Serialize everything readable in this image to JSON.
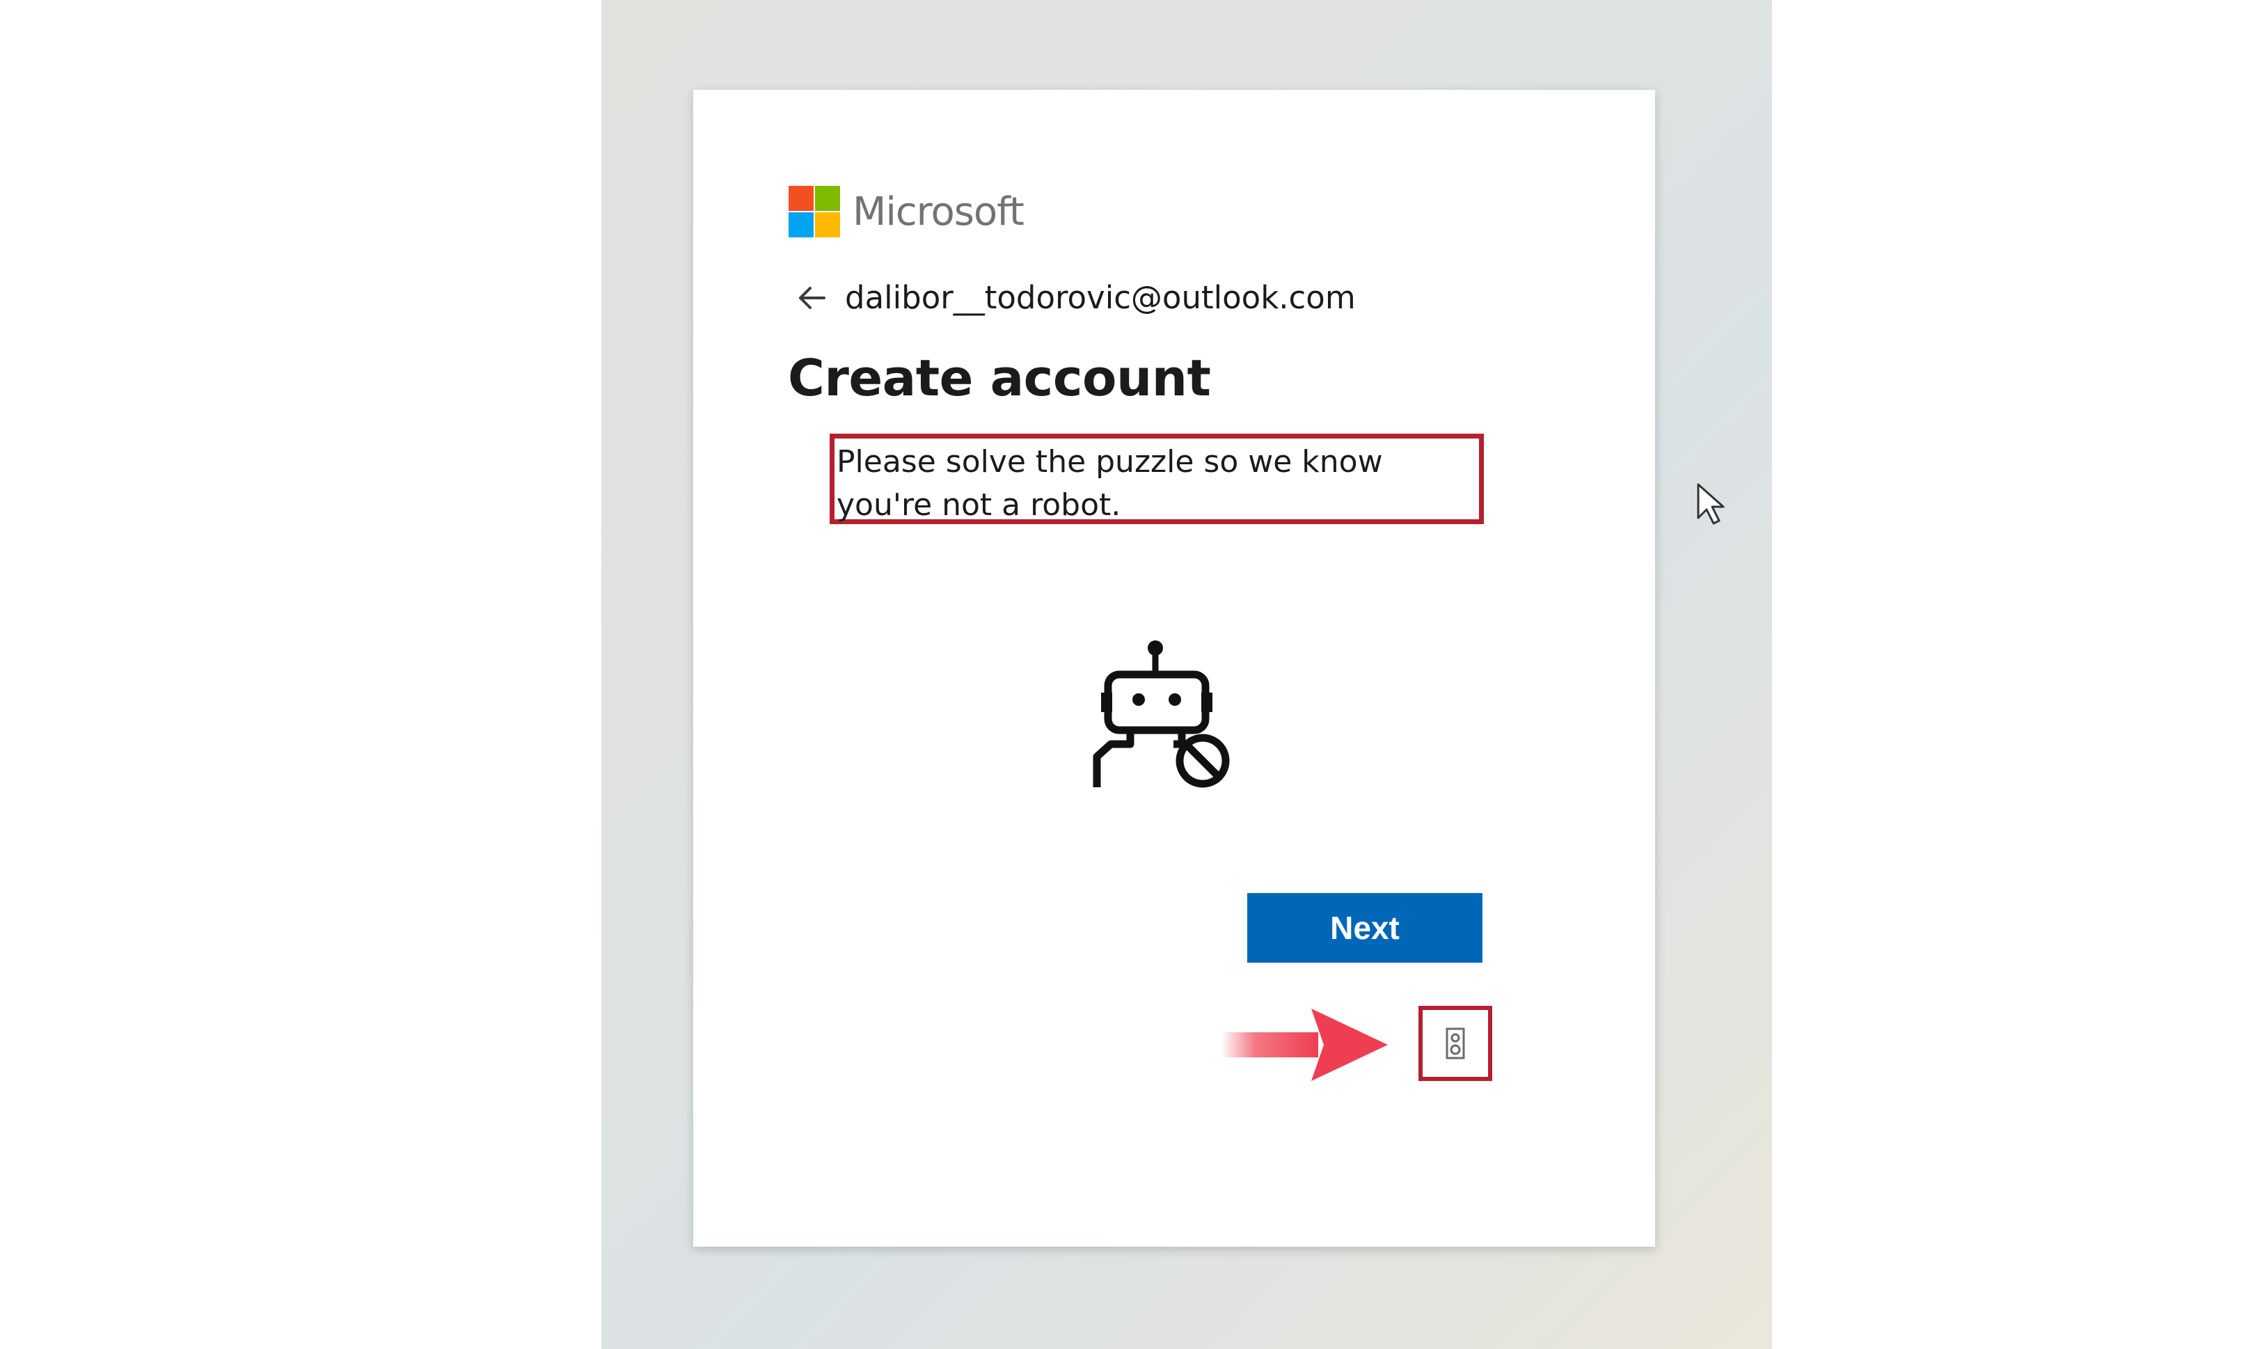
{
  "brand": {
    "name": "Microsoft",
    "colors": [
      "#f25022",
      "#7fba00",
      "#00a4ef",
      "#ffb900"
    ]
  },
  "identity": {
    "email": "dalibor__todorovic@outlook.com",
    "back_icon": "back-arrow-icon"
  },
  "page": {
    "title": "Create account",
    "prompt": "Please solve the puzzle so we know you're not a robot."
  },
  "illustration": {
    "icon": "robot-blocked-icon"
  },
  "actions": {
    "next_label": "Next",
    "audio_icon": "speaker-icon"
  },
  "annotation": {
    "highlight_color": "#b5202f",
    "arrow_color": "#ef3e51"
  },
  "colors": {
    "primary": "#0067b8",
    "text": "#1b1b1b",
    "logo_text": "#737373"
  }
}
